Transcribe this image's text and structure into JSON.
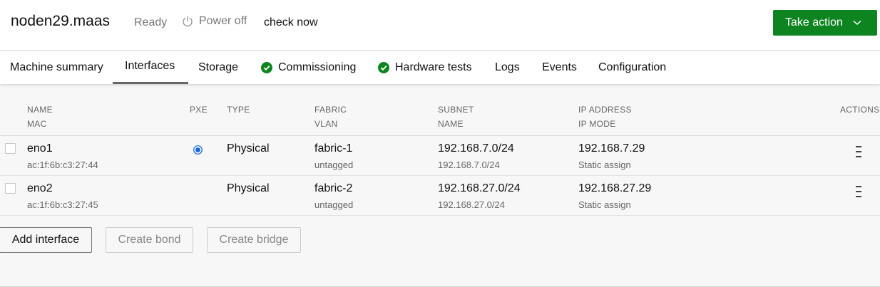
{
  "header": {
    "hostname": "noden29.maas",
    "status": "Ready",
    "power_label": "Power off",
    "check_now": "check now",
    "take_action": "Take action",
    "accent_color": "#0e8420"
  },
  "tabs": [
    {
      "label": "Machine summary"
    },
    {
      "label": "Interfaces",
      "active": true
    },
    {
      "label": "Storage"
    },
    {
      "label": "Commissioning",
      "icon": "success-check-icon"
    },
    {
      "label": "Hardware tests",
      "icon": "success-check-icon"
    },
    {
      "label": "Logs"
    },
    {
      "label": "Events"
    },
    {
      "label": "Configuration"
    }
  ],
  "table": {
    "headers": {
      "name": "NAME",
      "mac": "MAC",
      "pxe": "PXE",
      "type": "TYPE",
      "fabric": "FABRIC",
      "vlan": "VLAN",
      "subnet": "SUBNET",
      "subnet_name": "NAME",
      "ip_address": "IP ADDRESS",
      "ip_mode": "IP MODE",
      "actions": "ACTIONS"
    },
    "rows": [
      {
        "name": "eno1",
        "mac": "ac:1f:6b:c3:27:44",
        "pxe": true,
        "type": "Physical",
        "fabric": "fabric-1",
        "vlan": "untagged",
        "subnet": "192.168.7.0/24",
        "subnet_name": "192.168.7.0/24",
        "ip_address": "192.168.7.29",
        "ip_mode": "Static assign"
      },
      {
        "name": "eno2",
        "mac": "ac:1f:6b:c3:27:45",
        "pxe": false,
        "type": "Physical",
        "fabric": "fabric-2",
        "vlan": "untagged",
        "subnet": "192.168.27.0/24",
        "subnet_name": "192.168.27.0/24",
        "ip_address": "192.168.27.29",
        "ip_mode": "Static assign"
      }
    ]
  },
  "buttons": {
    "add_interface": "Add interface",
    "create_bond": "Create bond",
    "create_bridge": "Create bridge"
  }
}
